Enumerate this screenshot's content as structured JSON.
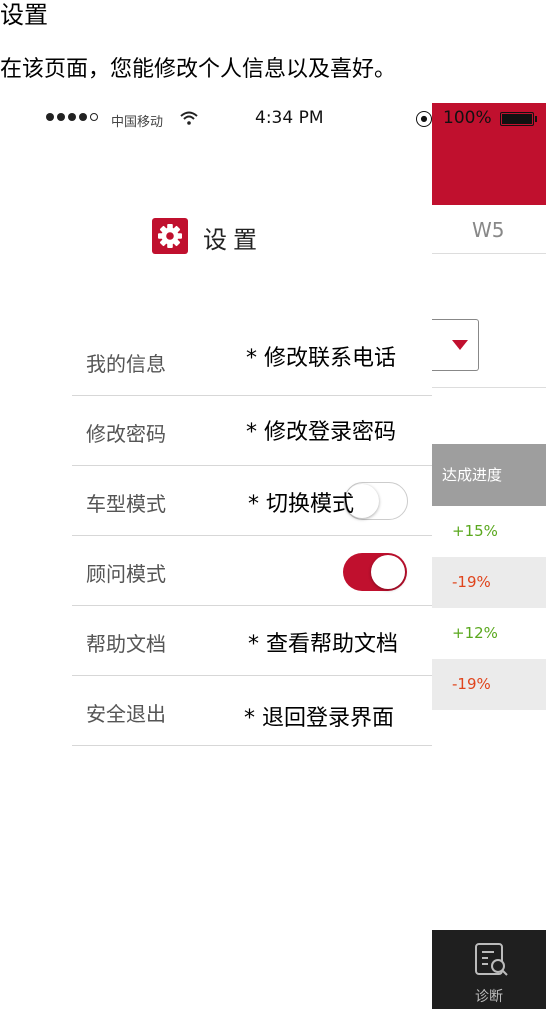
{
  "doc": {
    "title": "设置",
    "description": "在该页面，您能修改个人信息以及喜好。"
  },
  "status_bar": {
    "carrier": "中国移动",
    "time": "4:34 PM",
    "battery": "100%"
  },
  "background": {
    "week_label": "W5",
    "progress_header": "达成进度",
    "progress": [
      {
        "value": "+15%",
        "color": "#5aa81e"
      },
      {
        "value": "-19%",
        "color": "#e0441c"
      },
      {
        "value": "+12%",
        "color": "#5aa81e"
      },
      {
        "value": "-19%",
        "color": "#e0441c"
      }
    ],
    "bottom_tab_label": "诊断"
  },
  "settings": {
    "title": "设置",
    "items": [
      {
        "label": "我的信息",
        "note": "*  修改联系电话"
      },
      {
        "label": "修改密码",
        "note": "*  修改登录密码"
      },
      {
        "label": "车型模式",
        "note": "*  切换模式",
        "toggle": "off"
      },
      {
        "label": "顾问模式",
        "toggle": "on"
      },
      {
        "label": "帮助文档",
        "note": "*  查看帮助文档"
      },
      {
        "label": "安全退出",
        "note": "*  退回登录界面"
      }
    ]
  },
  "colors": {
    "accent": "#c0102e",
    "positive": "#5aa81e",
    "negative": "#e0441c"
  }
}
